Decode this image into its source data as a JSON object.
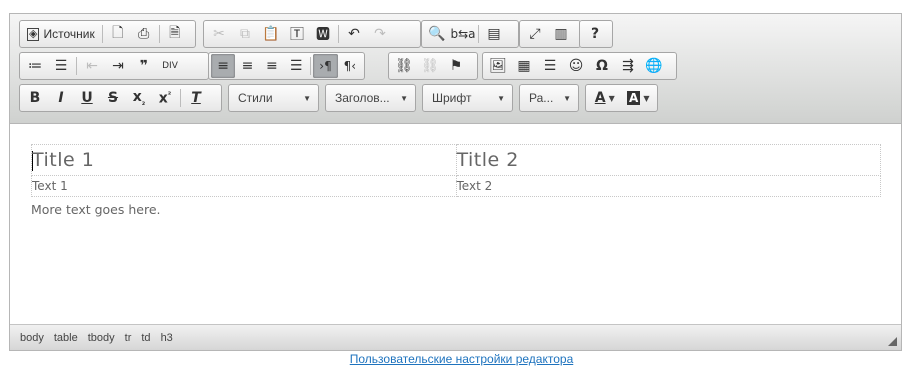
{
  "toolbar": {
    "source_label": "Источник",
    "styles_label": "Стили",
    "format_label": "Заголов...",
    "font_label": "Шрифт",
    "size_label": "Ра..."
  },
  "content": {
    "table": {
      "headers": [
        "Title 1",
        "Title 2"
      ],
      "cells": [
        "Text 1",
        "Text 2"
      ]
    },
    "more_text": "More text goes here."
  },
  "statusbar": {
    "path": [
      "body",
      "table",
      "tbody",
      "tr",
      "td",
      "h3"
    ]
  },
  "footer": {
    "link": "Пользовательские настройки редактора"
  },
  "colors": {
    "link": "#1e73be",
    "toolbar_bg": "#e4e5e4",
    "active_button": "#a9acaf"
  }
}
